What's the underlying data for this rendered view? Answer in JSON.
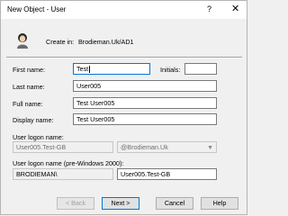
{
  "window": {
    "title": "New Object - User",
    "help_glyph": "?",
    "close_glyph": "✕"
  },
  "header": {
    "create_in_label": "Create in:",
    "create_in_path": "Brodieman.Uk/AD1"
  },
  "fields": {
    "first_name": {
      "label": "First name:",
      "value": "Test"
    },
    "initials": {
      "label": "Initials:",
      "value": ""
    },
    "last_name": {
      "label": "Last name:",
      "value": "User005"
    },
    "full_name": {
      "label": "Full name:",
      "value": "Test User005"
    },
    "display_name": {
      "label": "Display name:",
      "value": "Test User005"
    },
    "logon_name": {
      "label": "User logon name:",
      "value": "User005.Test-GB",
      "domain": "@Brodieman.Uk"
    },
    "pre2000": {
      "label": "User logon name (pre-Windows 2000):",
      "domain": "BRODIEMAN\\",
      "value": "User005.Test-GB"
    }
  },
  "buttons": {
    "back": "< Back",
    "next": "Next >",
    "cancel": "Cancel",
    "help": "Help"
  }
}
